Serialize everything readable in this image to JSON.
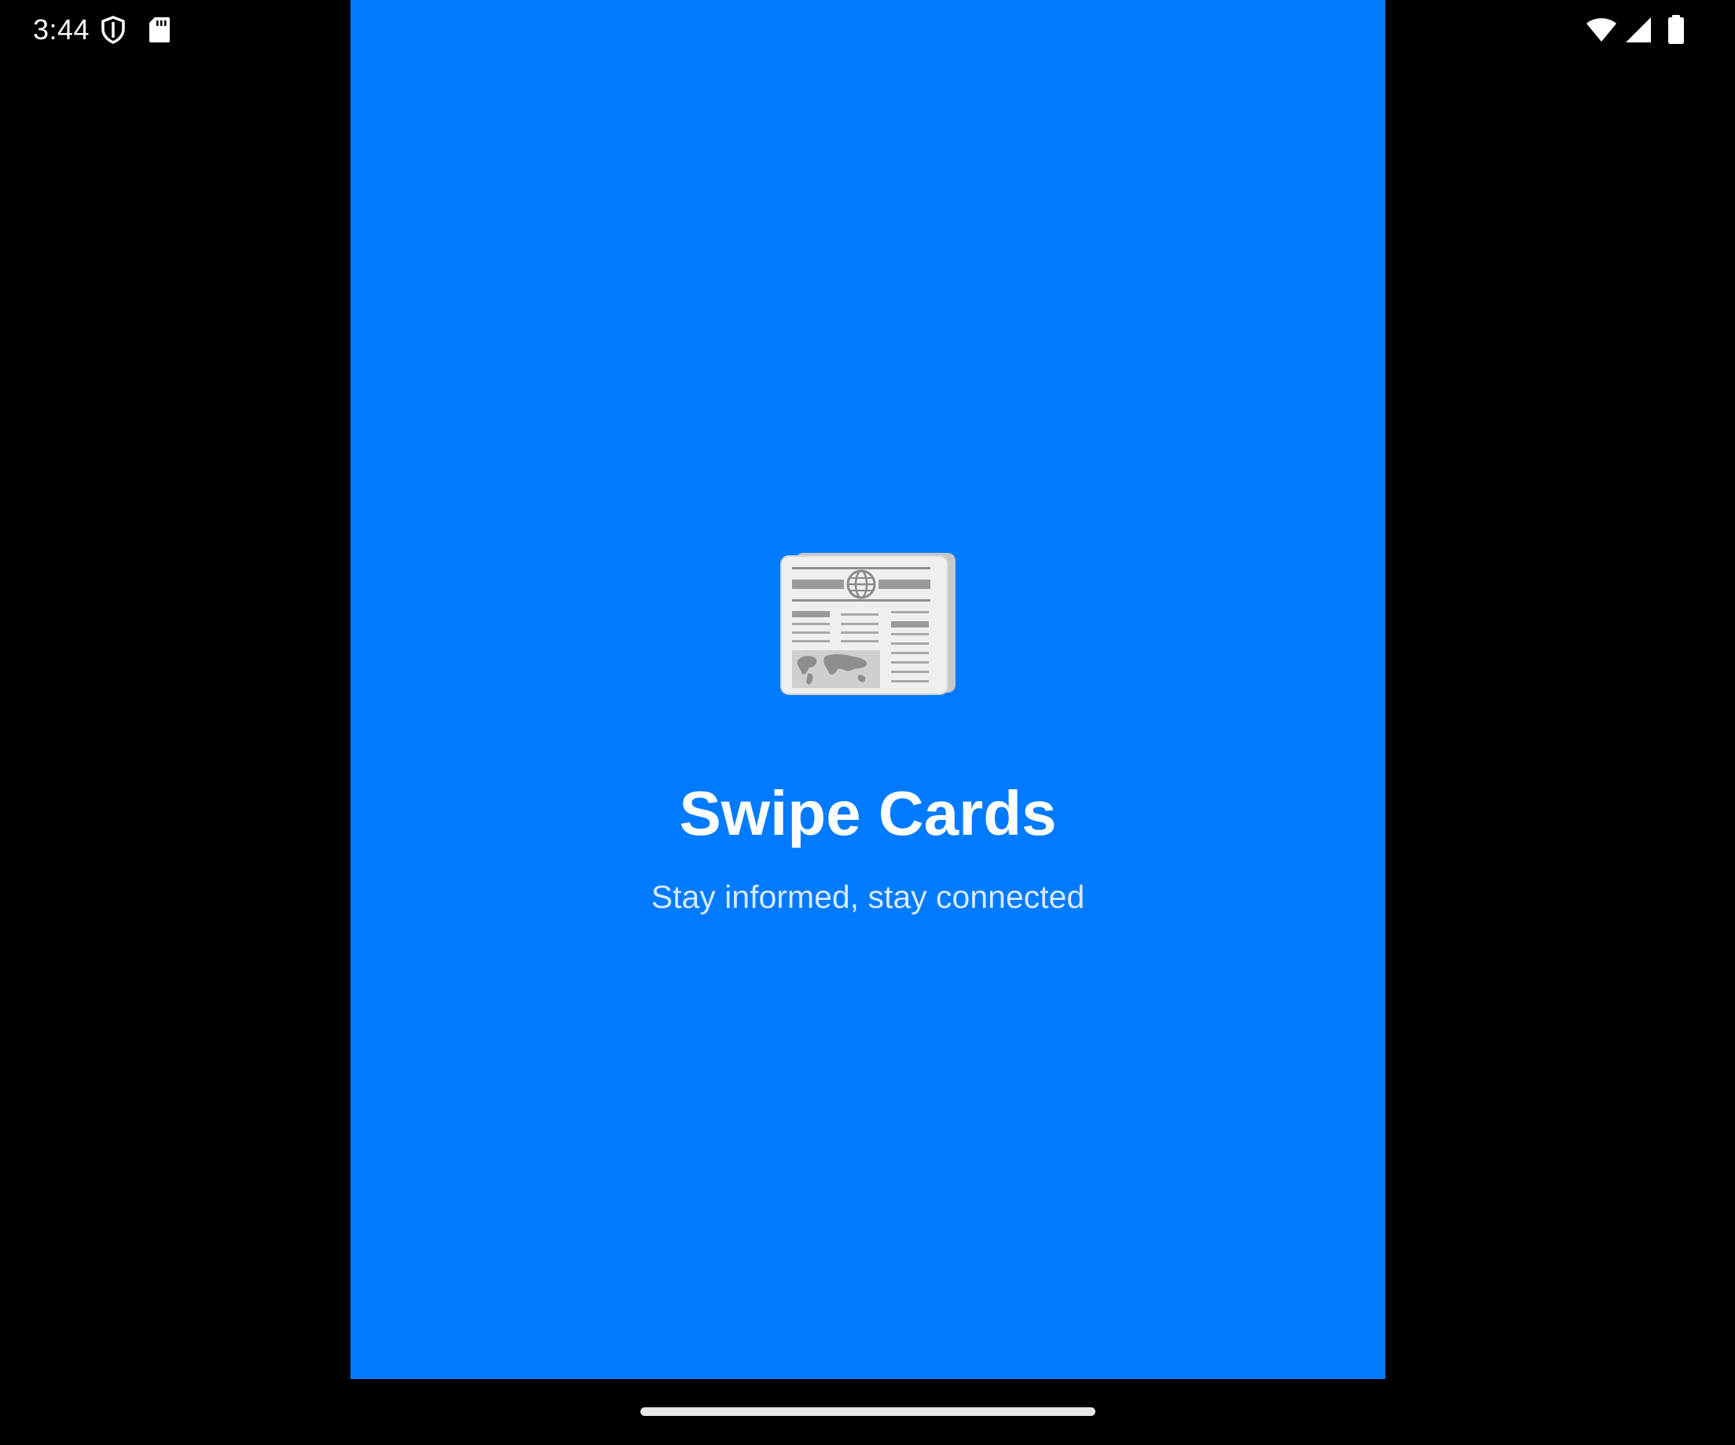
{
  "status_bar": {
    "time": "3:44",
    "left_icons": [
      "shield-icon",
      "sd-card-icon"
    ],
    "right_icons": [
      "wifi-icon",
      "cellular-signal-icon",
      "battery-icon"
    ]
  },
  "app": {
    "background_color": "#007AFF",
    "logo_icon": "newspaper-icon",
    "title": "Swipe Cards",
    "subtitle": "Stay informed, stay connected"
  },
  "navigation": {
    "gesture_handle": "home-gesture-bar"
  }
}
